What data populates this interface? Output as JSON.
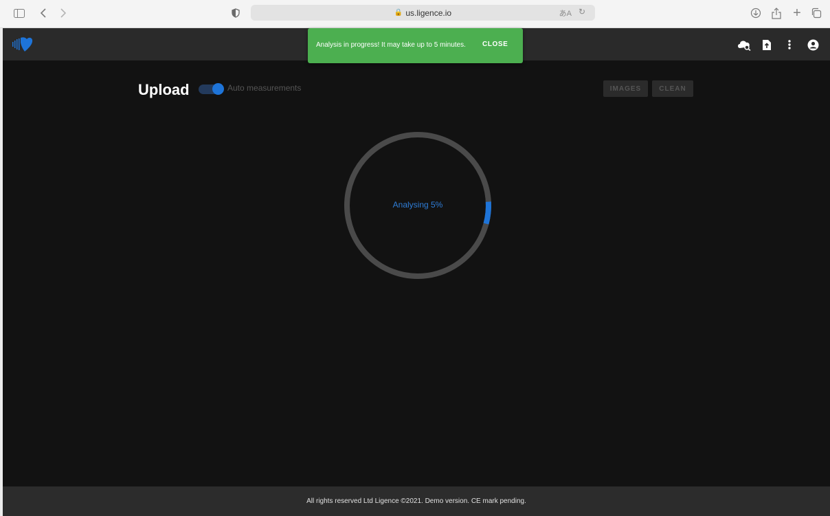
{
  "browser": {
    "url": "us.ligence.io",
    "icons": {
      "sidebar": "sidebar-icon",
      "back": "chevron-left-icon",
      "forward": "chevron-right-icon",
      "privacy": "shield-half-icon",
      "lock": "lock-icon",
      "translate": "translate-icon",
      "reload": "reload-icon",
      "download": "download-icon",
      "share": "share-icon",
      "new_tab": "plus-icon",
      "tabs": "tabs-overview-icon"
    }
  },
  "header": {
    "logo": "ligence-heart-logo",
    "icons": [
      "cloud-search-icon",
      "file-upload-icon",
      "more-vert-icon",
      "account-icon"
    ]
  },
  "upload": {
    "title": "Upload",
    "toggle_label": "Auto measurements",
    "toggle_on": true,
    "buttons": {
      "images": "IMAGES",
      "clean": "CLEAN"
    }
  },
  "snackbar": {
    "message": "Analysis in progress! It may take up to 5 minutes.",
    "close": "CLOSE"
  },
  "progress": {
    "label": "Analysing 5%",
    "value": 0.05
  },
  "footer": {
    "text": "All rights reserved Ltd Ligence ©2021. Demo version. CE mark pending."
  },
  "colors": {
    "accent": "#1e74d8",
    "snackbar": "#4caf50",
    "background": "#121212",
    "header": "#2a2a2a"
  }
}
